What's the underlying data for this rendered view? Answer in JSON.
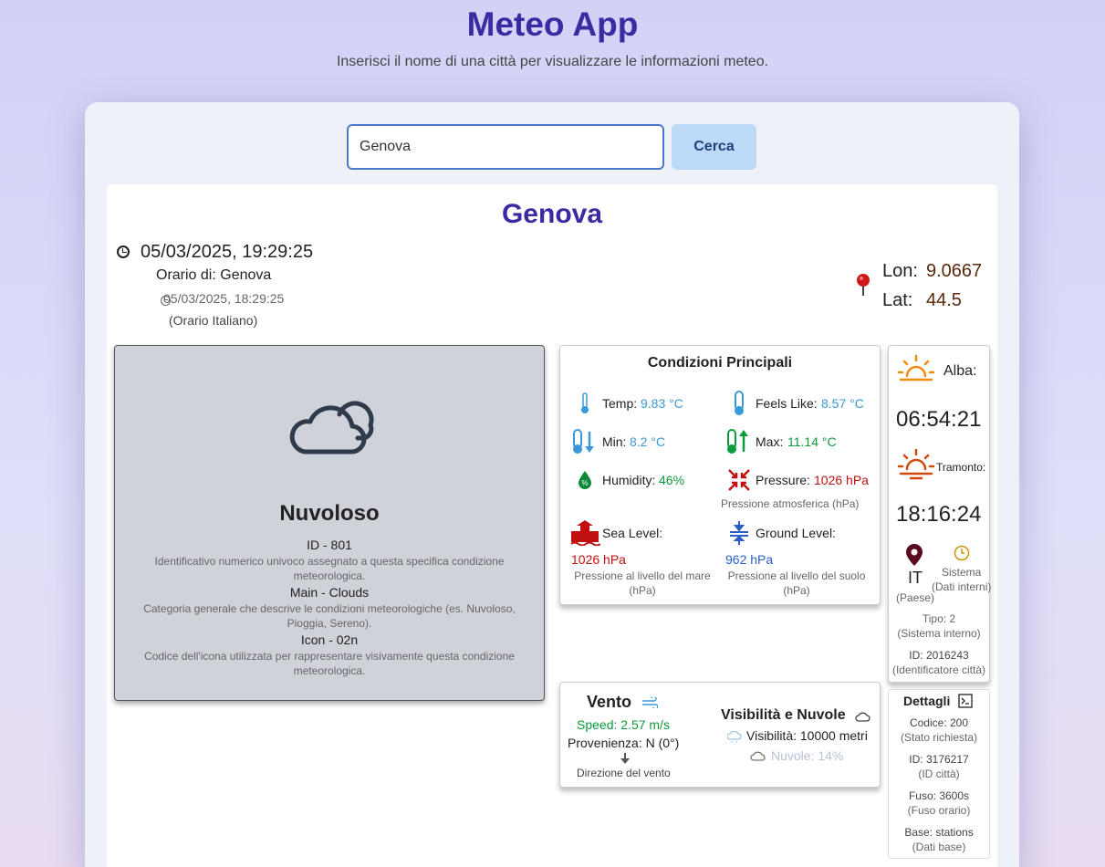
{
  "header": {
    "title": "Meteo App",
    "subtitle": "Inserisci il nome di una città per visualizzare le informazioni meteo."
  },
  "search": {
    "value": "Genova",
    "button": "Cerca"
  },
  "city": "Genova",
  "time": {
    "local": "05/03/2025, 19:29:25",
    "label": "Orario di: Genova",
    "italian": "05/03/2025, 18:29:25",
    "italian_label": "(Orario Italiano)"
  },
  "coords": {
    "lon_label": "Lon:",
    "lon": "9.0667",
    "lat_label": "Lat:",
    "lat": "44.5"
  },
  "description": {
    "title": "Nuvoloso",
    "id": "ID - 801",
    "id_desc": "Identificativo numerico univoco assegnato a questa specifica condizione meteorologica.",
    "main": "Main - Clouds",
    "main_desc": "Categoria generale che descrive le condizioni meteorologiche (es. Nuvoloso, Pioggia, Sereno).",
    "icon": "Icon - 02n",
    "icon_desc": "Codice dell'icona utilizzata per rappresentare visivamente questa condizione meteorologica."
  },
  "conditions": {
    "title": "Condizioni Principali",
    "temp_label": "Temp:",
    "temp": "9.83 °C",
    "feels_label": "Feels Like:",
    "feels": "8.57 °C",
    "min_label": "Min:",
    "min": "8.2 °C",
    "max_label": "Max:",
    "max": "11.14 °C",
    "humidity_label": "Humidity:",
    "humidity": "46%",
    "pressure_label": "Pressure:",
    "pressure": "1026 hPa",
    "pressure_desc": "Pressione atmosferica (hPa)",
    "sea_label": "Sea Level:",
    "sea": "1026 hPa",
    "sea_desc": "Pressione al livello del mare (hPa)",
    "ground_label": "Ground Level:",
    "ground": "962 hPa",
    "ground_desc": "Pressione al livello del suolo (hPa)"
  },
  "sun": {
    "alba_label": "Alba:",
    "alba": "06:54:21",
    "tramonto_label": "Tramonto:",
    "tramonto": "18:16:24"
  },
  "sys": {
    "country": "IT",
    "country_label": "(Paese)",
    "sistema": "Sistema",
    "sistema_label": "(Dati interni)",
    "tipo": "Tipo: 2",
    "tipo_label": "(Sistema interno)",
    "id": "ID: 2016243",
    "id_label": "(Identificatore città)"
  },
  "wind": {
    "title": "Vento",
    "speed": "Speed: 2.57 m/s",
    "dir": "Provenienza: N (0°)",
    "dir_label": "Direzione del vento"
  },
  "visibility": {
    "title": "Visibilità e Nuvole",
    "vis": "Visibilità: 10000 metri",
    "clouds": "Nuvole: 14%"
  },
  "details": {
    "title": "Dettagli",
    "codice": "Codice: 200",
    "codice_label": "(Stato richiesta)",
    "id": "ID: 3176217",
    "id_label": "(ID città)",
    "fuso": "Fuso: 3600s",
    "fuso_label": "(Fuso orario)",
    "base": "Base: stations",
    "base_label": "(Dati base)"
  },
  "colors": {
    "accent": "#3b2ba3",
    "blue": "#3a9ad9",
    "green": "#0c9a3c",
    "red": "#c01010"
  }
}
